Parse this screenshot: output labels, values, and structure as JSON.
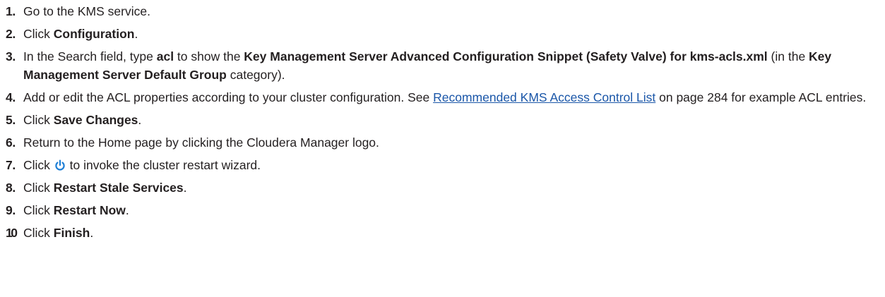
{
  "steps": [
    {
      "number": "1.",
      "parts": [
        {
          "t": "text",
          "v": "Go to the KMS service."
        }
      ]
    },
    {
      "number": "2.",
      "parts": [
        {
          "t": "text",
          "v": "Click "
        },
        {
          "t": "bold",
          "v": "Configuration"
        },
        {
          "t": "text",
          "v": "."
        }
      ]
    },
    {
      "number": "3.",
      "parts": [
        {
          "t": "text",
          "v": "In the Search field, type "
        },
        {
          "t": "bold",
          "v": "acl"
        },
        {
          "t": "text",
          "v": " to show the "
        },
        {
          "t": "bold",
          "v": "Key Management Server Advanced Configuration Snippet (Safety Valve) for kms-acls.xml"
        },
        {
          "t": "text",
          "v": " (in the "
        },
        {
          "t": "bold",
          "v": "Key Management Server Default Group"
        },
        {
          "t": "text",
          "v": " category)."
        }
      ]
    },
    {
      "number": "4.",
      "parts": [
        {
          "t": "text",
          "v": "Add or edit the ACL properties according to your cluster configuration. See "
        },
        {
          "t": "link",
          "v": "Recommended KMS Access Control List"
        },
        {
          "t": "text",
          "v": " on page 284 for example ACL entries."
        }
      ]
    },
    {
      "number": "5.",
      "parts": [
        {
          "t": "text",
          "v": "Click "
        },
        {
          "t": "bold",
          "v": "Save Changes"
        },
        {
          "t": "text",
          "v": "."
        }
      ]
    },
    {
      "number": "6.",
      "parts": [
        {
          "t": "text",
          "v": "Return to the Home page by clicking the Cloudera Manager logo."
        }
      ]
    },
    {
      "number": "7.",
      "parts": [
        {
          "t": "text",
          "v": "Click "
        },
        {
          "t": "icon",
          "v": "power-icon"
        },
        {
          "t": "text",
          "v": " to invoke the cluster restart wizard."
        }
      ]
    },
    {
      "number": "8.",
      "parts": [
        {
          "t": "text",
          "v": "Click "
        },
        {
          "t": "bold",
          "v": "Restart Stale Services"
        },
        {
          "t": "text",
          "v": "."
        }
      ]
    },
    {
      "number": "9.",
      "parts": [
        {
          "t": "text",
          "v": "Click "
        },
        {
          "t": "bold",
          "v": "Restart Now"
        },
        {
          "t": "text",
          "v": "."
        }
      ]
    },
    {
      "number": "10",
      "parts": [
        {
          "t": "text",
          "v": "Click "
        },
        {
          "t": "bold",
          "v": "Finish"
        },
        {
          "t": "text",
          "v": "."
        }
      ]
    }
  ],
  "colors": {
    "text": "#231f20",
    "link": "#1a56a8",
    "icon": "#1e7fd6"
  }
}
